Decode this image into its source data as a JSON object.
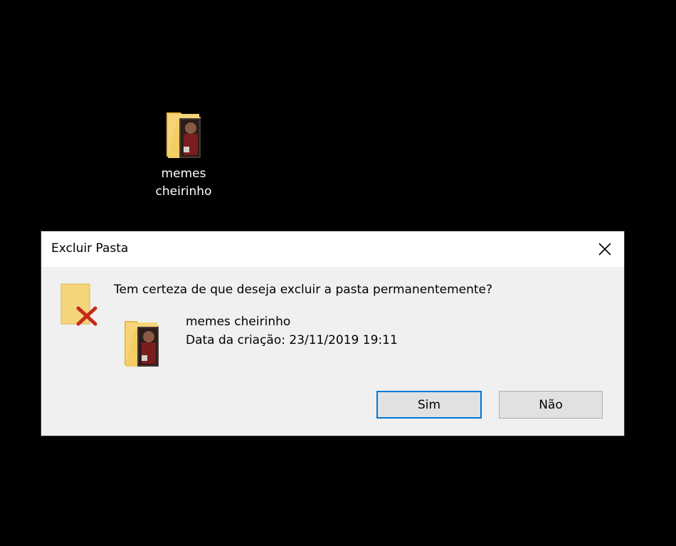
{
  "desktop": {
    "icon": {
      "label_line1": "memes",
      "label_line2": "cheirinho",
      "icon": "folder-with-photo-icon"
    }
  },
  "dialog": {
    "title": "Excluir Pasta",
    "close_icon": "close-icon",
    "warning_icon": "folder-delete-icon",
    "question": "Tem certeza de que deseja excluir a pasta permanentemente?",
    "item": {
      "name": "memes cheirinho",
      "created": "Data da criação: 23/11/2019 19:11",
      "icon": "folder-with-photo-icon"
    },
    "buttons": {
      "yes": "Sim",
      "no": "Não"
    }
  },
  "colors": {
    "background": "#000000",
    "dialog_bg": "#f0f0f0",
    "titlebar_bg": "#ffffff",
    "focus_border": "#0078d7",
    "folder": "#f6d57a",
    "delete_x": "#c42b1c"
  }
}
